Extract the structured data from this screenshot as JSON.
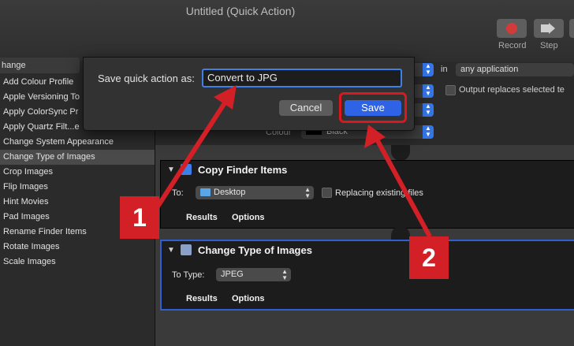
{
  "window": {
    "title": "Untitled (Quick Action)",
    "toolbar": [
      {
        "label": "Record",
        "icon": "record-icon"
      },
      {
        "label": "Step",
        "icon": "step-icon"
      }
    ]
  },
  "sidebar": {
    "search_value": "hange",
    "items": [
      {
        "label": "Add Colour Profile"
      },
      {
        "label": "Apple Versioning To"
      },
      {
        "label": "Apply ColorSync Pr"
      },
      {
        "label": "Apply Quartz Filt...e"
      },
      {
        "label": "Change System Appearance"
      },
      {
        "label": "Change Type of Images",
        "selected": true
      },
      {
        "label": "Crop Images"
      },
      {
        "label": "Flip Images"
      },
      {
        "label": "Hint Movies"
      },
      {
        "label": "Pad Images"
      },
      {
        "label": "Rename Finder Items"
      },
      {
        "label": "Rotate Images"
      },
      {
        "label": "Scale Images"
      }
    ]
  },
  "workflow_options": {
    "in_label": "in",
    "application_value": "any application",
    "output_replaces_label": "Output replaces selected te",
    "colour_label": "Colour",
    "colour_value": "Black"
  },
  "actions": [
    {
      "title": "Copy Finder Items",
      "field_label": "To:",
      "field_value": "Desktop",
      "checkbox_label": "Replacing existing files",
      "tabs": [
        "Results",
        "Options"
      ]
    },
    {
      "title": "Change Type of Images",
      "field_label": "To Type:",
      "field_value": "JPEG",
      "tabs": [
        "Results",
        "Options"
      ]
    }
  ],
  "dialog": {
    "label": "Save quick action as:",
    "input_value": "Convert to JPG",
    "cancel_label": "Cancel",
    "save_label": "Save"
  },
  "annotations": {
    "badge1": "1",
    "badge2": "2",
    "color": "#d31f26"
  }
}
